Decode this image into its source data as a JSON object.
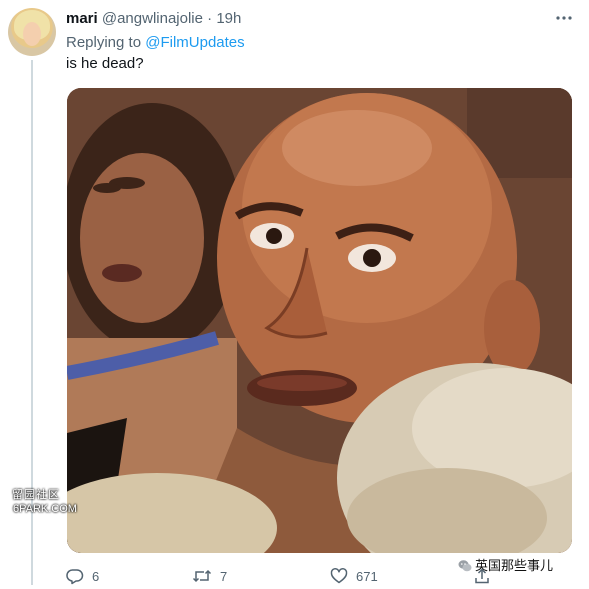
{
  "tweet": {
    "author_name": "mari",
    "handle": "@angwlinajolie",
    "separator": "·",
    "time": "19h",
    "replying_to_prefix": "Replying to",
    "replying_to_mention": "@FilmUpdates",
    "text": "is he dead?",
    "more_icon": "ellipsis-icon"
  },
  "actions": {
    "reply_count": "6",
    "retweet_count": "7",
    "like_count": "671",
    "reply_icon": "reply-icon",
    "retweet_icon": "retweet-icon",
    "like_icon": "heart-icon",
    "share_icon": "share-icon"
  },
  "watermarks": {
    "left_cn": "留园社区",
    "left_brand": "6PARK.COM",
    "right_text": "英国那些事儿",
    "right_icon": "wechat-icon"
  },
  "colors": {
    "text": "#0f1419",
    "secondary": "#536471",
    "link": "#1d9bf0",
    "thread_line": "#cfd9de"
  }
}
